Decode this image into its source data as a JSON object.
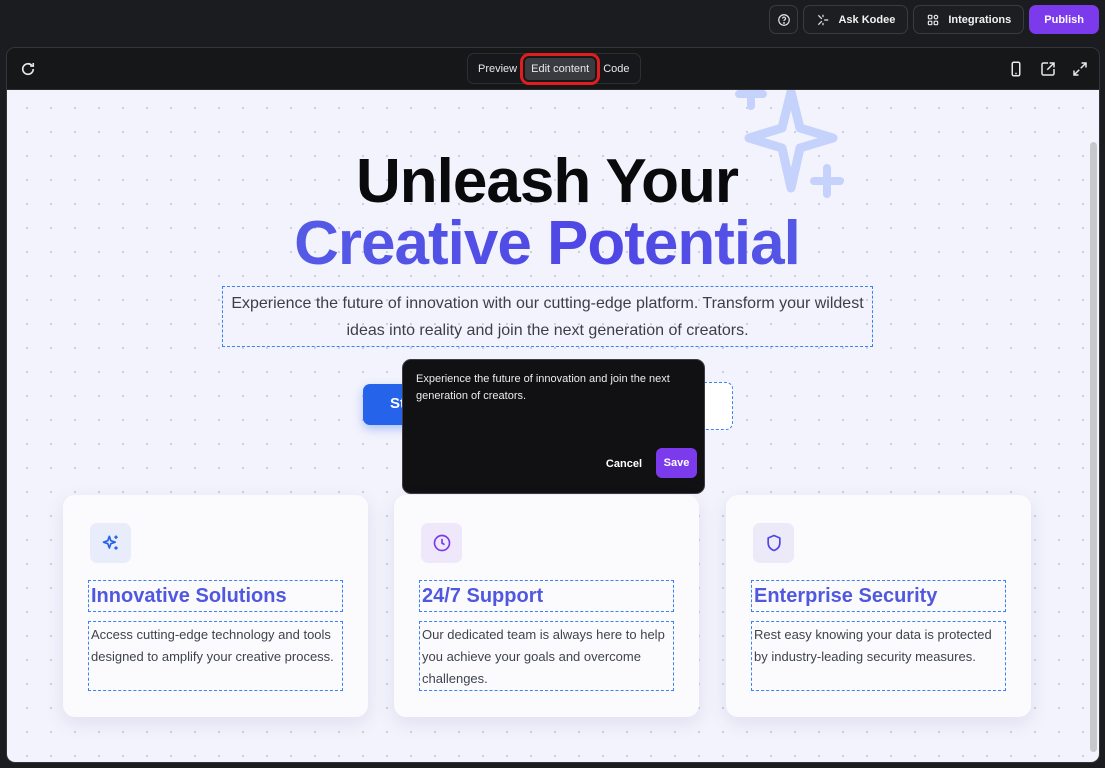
{
  "topbar": {
    "help_icon": "help-circle-icon",
    "ask_label": "Ask Kodee",
    "integrations_label": "Integrations",
    "publish_label": "Publish"
  },
  "frame": {
    "tabs": [
      {
        "label": "Preview",
        "active": false
      },
      {
        "label": "Edit content",
        "active": true
      },
      {
        "label": "Code",
        "active": false
      }
    ],
    "right_icons": [
      "mobile-icon",
      "external-link-icon",
      "fullscreen-icon"
    ]
  },
  "hero": {
    "line1": "Unleash Your",
    "line2": "Creative Potential",
    "subtitle": "Experience the future of innovation with our cutting-edge platform. Transform your wildest ideas into reality and join the next generation of creators.",
    "cta_primary_partial": "St"
  },
  "editor": {
    "text": "Experience the future of innovation and join the next generation of creators.",
    "cancel_label": "Cancel",
    "save_label": "Save"
  },
  "features": [
    {
      "title": "Innovative Solutions",
      "desc": "Access cutting-edge technology and tools designed to amplify your creative process.",
      "icon": "sparkles-icon",
      "accent": "#2563eb",
      "bg": "#e8ecfb"
    },
    {
      "title": "24/7 Support",
      "desc": "Our dedicated team is always here to help you achieve your goals and overcome challenges.",
      "icon": "clock-icon",
      "accent": "#7c3aed",
      "bg": "#efe8fb"
    },
    {
      "title": "Enterprise Security",
      "desc": "Rest easy knowing your data is protected by industry-leading security measures.",
      "icon": "shield-icon",
      "accent": "#4f46e5",
      "bg": "#eceaf8"
    }
  ],
  "colors": {
    "accent_purple": "#7c3aed",
    "accent_blue": "#2563eb",
    "highlight_red": "#e11d1d"
  }
}
